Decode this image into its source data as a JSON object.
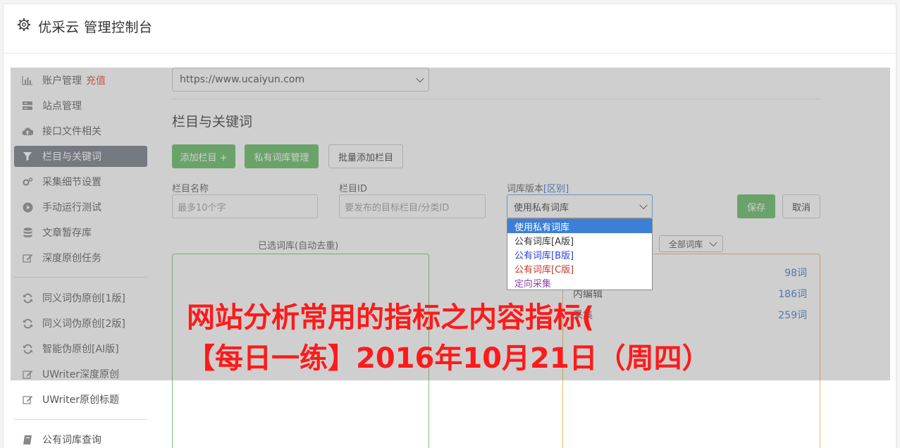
{
  "header": {
    "title": "优采云 管理控制台"
  },
  "sidebar": {
    "items": [
      {
        "label": "账户管理",
        "badge": "充值",
        "icon": "bar-chart-icon"
      },
      {
        "label": "站点管理",
        "icon": "server-icon"
      },
      {
        "label": "接口文件相关",
        "icon": "cloud-upload-icon"
      },
      {
        "label": "栏目与关键词",
        "icon": "filter-icon",
        "active": true
      },
      {
        "label": "采集细节设置",
        "icon": "cogs-icon"
      },
      {
        "label": "手动运行测试",
        "icon": "play-circle-icon"
      },
      {
        "label": "文章暂存库",
        "icon": "database-icon"
      },
      {
        "label": "深度原创任务",
        "icon": "edit-icon"
      },
      {
        "label": "同义词伪原创[1版]",
        "icon": "refresh-icon"
      },
      {
        "label": "同义词伪原创[2版]",
        "icon": "refresh-icon"
      },
      {
        "label": "智能伪原创[AI版]",
        "icon": "refresh-icon"
      },
      {
        "label": "UWriter深度原创",
        "icon": "edit-icon"
      },
      {
        "label": "UWriter原创标题",
        "icon": "edit-icon"
      },
      {
        "label": "公有词库查询",
        "icon": "book-icon"
      }
    ]
  },
  "main": {
    "site_select": "https://www.ucaiyun.com",
    "section_title": "栏目与关键词",
    "buttons": {
      "add_column": "添加栏目 +",
      "private_lib": "私有词库管理",
      "batch_add": "批量添加栏目",
      "save": "保存",
      "cancel": "取消"
    },
    "form": {
      "column_name_label": "栏目名称",
      "column_name_placeholder": "最多10个字",
      "column_id_label": "栏目ID",
      "column_id_placeholder": "要发布的目标栏目/分类ID",
      "version_label": "词库版本",
      "version_link": "[区别]",
      "version_value": "使用私有词库",
      "version_options": [
        {
          "label": "使用私有词库",
          "color": "#ffffff"
        },
        {
          "label": "公有词库[A版]",
          "color": "#333333"
        },
        {
          "label": "公有词库[B版]",
          "color": "#2b3fd6"
        },
        {
          "label": "公有词库[C版]",
          "color": "#c0392b"
        },
        {
          "label": "定向采集",
          "color": "#8e44ad"
        }
      ]
    },
    "selected_label": "已选词库(自动去重)",
    "filter_value": "全部词库",
    "library_rows": [
      {
        "name": "",
        "count": "98词"
      },
      {
        "name": "内编辑",
        "count": "186词"
      },
      {
        "name": "采集",
        "count": "259词"
      }
    ]
  },
  "promo": {
    "line1": "网站分析常用的指标之内容指标(",
    "line2": "【每日一练】2016年10月21日（周四）"
  },
  "colors": {
    "accent_green": "#5cb85c",
    "active_sidebar": "#6f7782",
    "promo_red": "#ff1a1a"
  }
}
